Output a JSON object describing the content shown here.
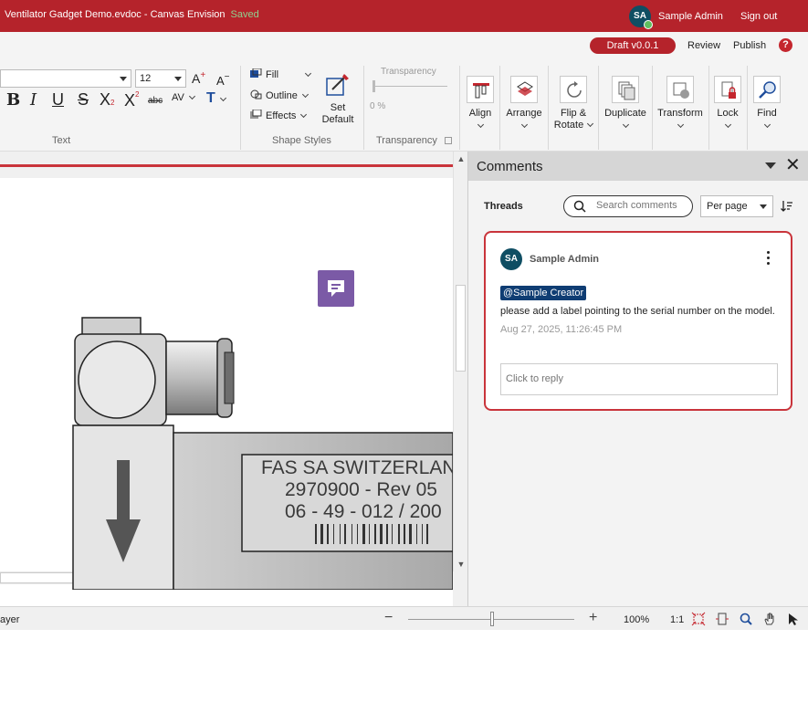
{
  "titlebar": {
    "title": "Ventilator Gadget Demo.evdoc - Canvas Envision",
    "saved": "Saved",
    "user_initials": "SA",
    "user_name": "Sample Admin",
    "sign_out": "Sign out"
  },
  "ribbon": {
    "draft_badge": "Draft v0.0.1",
    "review": "Review",
    "publish": "Publish",
    "help": "?",
    "text_group": {
      "label": "Text",
      "font_size": "12",
      "grow": "A",
      "shrink": "A",
      "bold": "B",
      "italic": "I",
      "underline": "U",
      "strike": "S",
      "subscript": "X",
      "superscript": "X",
      "abc": "abc",
      "spacing": "AV",
      "textcolor": "T"
    },
    "shape_styles": {
      "label": "Shape Styles",
      "fill": "Fill",
      "outline": "Outline",
      "effects": "Effects",
      "set_default_1": "Set",
      "set_default_2": "Default"
    },
    "transparency": {
      "label": "Transparency",
      "slider_label": "Transparency",
      "value": "0 %"
    },
    "tools": [
      {
        "label": "Align"
      },
      {
        "label": "Arrange"
      },
      {
        "label": "Flip &",
        "label2": "Rotate"
      },
      {
        "label": "Duplicate"
      },
      {
        "label": "Transform"
      },
      {
        "label": "Lock"
      },
      {
        "label": "Find"
      }
    ]
  },
  "canvas": {
    "plate_line1": "FAS SA SWITZERLAN",
    "plate_line2": "2970900 - Rev 05",
    "plate_line3": "06 - 49   -   012 / 200"
  },
  "comments": {
    "title": "Comments",
    "threads_label": "Threads",
    "search_placeholder": "Search comments",
    "per_page": "Per page",
    "thread": {
      "initials": "SA",
      "author": "Sample Admin",
      "mention": "@Sample Creator",
      "text": "please add a label pointing to the serial number on the model.",
      "date": "Aug 27, 2025, 11:26:45 PM",
      "reply_placeholder": "Click to reply"
    }
  },
  "status": {
    "left_text": "ayer",
    "zoom_minus": "−",
    "zoom_plus": "+",
    "zoom_level": "100%",
    "zoom_one": "1:1"
  },
  "colors": {
    "brand_red": "#b5232b",
    "avatar_teal": "#0f4e63",
    "mention_blue": "#0f3d73",
    "comment_pin": "#7b5aa6"
  }
}
